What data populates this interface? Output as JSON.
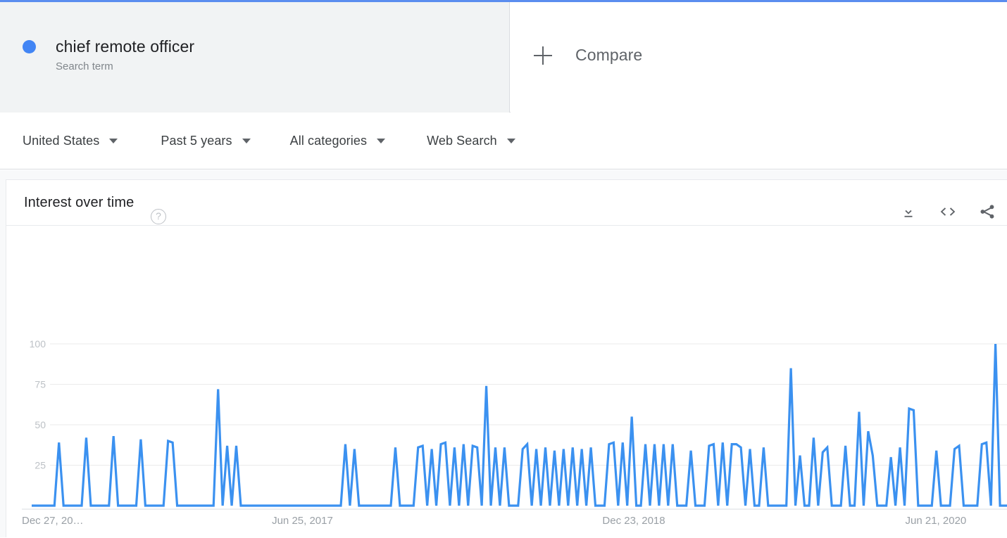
{
  "app": {
    "accent_color": "#5b8def"
  },
  "term_card": {
    "title": "chief remote officer",
    "subtitle": "Search term",
    "dot_color": "#4285f4"
  },
  "compare": {
    "label": "Compare",
    "icon": "plus-icon"
  },
  "filters": [
    {
      "label": "United States",
      "icon": "chevron-down-icon"
    },
    {
      "label": "Past 5 years",
      "icon": "chevron-down-icon"
    },
    {
      "label": "All categories",
      "icon": "chevron-down-icon"
    },
    {
      "label": "Web Search",
      "icon": "chevron-down-icon"
    }
  ],
  "chart_card": {
    "title": "Interest over time",
    "help_icon": "question-mark-icon",
    "help_glyph": "?",
    "tools": [
      {
        "name": "download-icon",
        "label": "Download"
      },
      {
        "name": "embed-code-icon",
        "label": "Embed"
      },
      {
        "name": "share-icon",
        "label": "Share"
      }
    ]
  },
  "chart_data": {
    "type": "line",
    "title": "Interest over time",
    "xlabel": "",
    "ylabel": "",
    "ylim": [
      0,
      100
    ],
    "yticks": [
      25,
      50,
      75,
      100
    ],
    "grid": true,
    "legend_position": "top-card",
    "series_name": "chief remote officer",
    "series_color": "#3b91f0",
    "line_color": "#3b91f0",
    "xtick_labels": [
      "Dec 27, 20…",
      "Jun 25, 2017",
      "Dec 23, 2018",
      "Jun 21, 2020"
    ],
    "xtick_positions": [
      0,
      0.277,
      0.616,
      0.925
    ],
    "x_start": "Dec 27, 2015",
    "x_end": "Dec 2020",
    "values": [
      0,
      0,
      0,
      0,
      0,
      0,
      39,
      0,
      0,
      0,
      0,
      0,
      42,
      0,
      0,
      0,
      0,
      0,
      43,
      0,
      0,
      0,
      0,
      0,
      41,
      0,
      0,
      0,
      0,
      0,
      40,
      39,
      0,
      0,
      0,
      0,
      0,
      0,
      0,
      0,
      0,
      72,
      0,
      37,
      0,
      37,
      0,
      0,
      0,
      0,
      0,
      0,
      0,
      0,
      0,
      0,
      0,
      0,
      0,
      0,
      0,
      0,
      0,
      0,
      0,
      0,
      0,
      0,
      0,
      38,
      0,
      35,
      0,
      0,
      0,
      0,
      0,
      0,
      0,
      0,
      36,
      0,
      0,
      0,
      0,
      36,
      37,
      0,
      35,
      0,
      38,
      39,
      0,
      36,
      0,
      38,
      0,
      37,
      36,
      0,
      74,
      0,
      36,
      0,
      36,
      0,
      0,
      0,
      35,
      38,
      0,
      35,
      0,
      36,
      0,
      34,
      0,
      35,
      0,
      36,
      0,
      35,
      0,
      36,
      0,
      0,
      0,
      38,
      39,
      0,
      39,
      0,
      55,
      0,
      0,
      38,
      0,
      38,
      0,
      38,
      0,
      38,
      0,
      0,
      0,
      34,
      0,
      0,
      0,
      37,
      38,
      0,
      39,
      0,
      38,
      38,
      36,
      0,
      35,
      0,
      0,
      36,
      0,
      0,
      0,
      0,
      0,
      85,
      0,
      31,
      0,
      0,
      42,
      0,
      33,
      36,
      0,
      0,
      0,
      37,
      0,
      0,
      58,
      0,
      46,
      31,
      0,
      0,
      0,
      30,
      0,
      36,
      0,
      60,
      59,
      0,
      0,
      0,
      0,
      34,
      0,
      0,
      0,
      35,
      37,
      0,
      0,
      0,
      0,
      38,
      39,
      0,
      100,
      0,
      0,
      0
    ]
  }
}
